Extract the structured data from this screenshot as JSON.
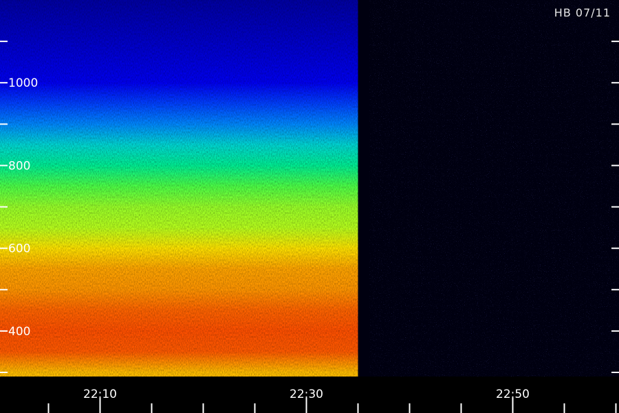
{
  "station_label": "HB 07/11",
  "chart_data": {
    "type": "heatmap",
    "title": "",
    "xlabel": "",
    "ylabel": "",
    "x_tick_labels": [
      "22:10",
      "22:30",
      "22:50"
    ],
    "x_tick_values_minutes": [
      0,
      20,
      40
    ],
    "x_range_minutes": [
      -9.7,
      50.3
    ],
    "minor_x_tick_interval_minutes": 5,
    "y_tick_labels": [
      "400",
      "600",
      "800",
      "1000"
    ],
    "y_tick_values": [
      400,
      600,
      800,
      1000
    ],
    "y_range": [
      290,
      1200
    ],
    "minor_y_tick_interval": 100,
    "signal_end_time": "22:35",
    "colormap": [
      "#00007a",
      "#0000ff",
      "#00c8ff",
      "#00ff66",
      "#ffff00",
      "#ff7a00",
      "#ff2a00"
    ],
    "intensity_profile": [
      {
        "y": 1200,
        "level": 0.05
      },
      {
        "y": 1100,
        "level": 0.1
      },
      {
        "y": 1000,
        "level": 0.15
      },
      {
        "y": 950,
        "level": 0.22
      },
      {
        "y": 900,
        "level": 0.28
      },
      {
        "y": 850,
        "level": 0.38
      },
      {
        "y": 800,
        "level": 0.45
      },
      {
        "y": 750,
        "level": 0.55
      },
      {
        "y": 700,
        "level": 0.6
      },
      {
        "y": 650,
        "level": 0.62
      },
      {
        "y": 600,
        "level": 0.7
      },
      {
        "y": 550,
        "level": 0.78
      },
      {
        "y": 500,
        "level": 0.8
      },
      {
        "y": 450,
        "level": 0.88
      },
      {
        "y": 400,
        "level": 0.92
      },
      {
        "y": 350,
        "level": 0.9
      },
      {
        "y": 300,
        "level": 0.75
      }
    ]
  }
}
